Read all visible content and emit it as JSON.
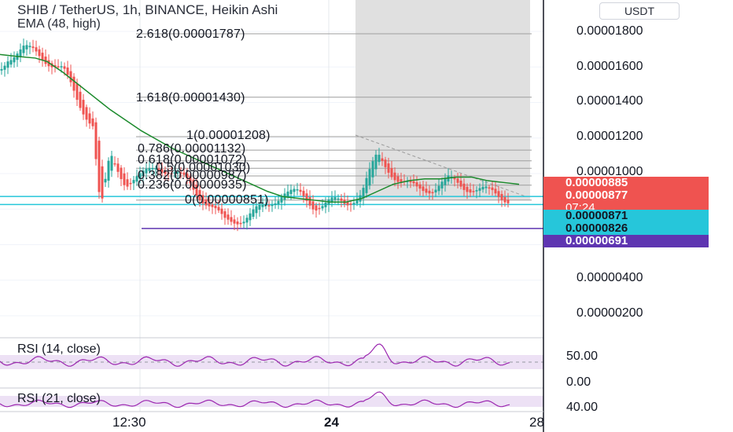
{
  "header": {
    "symbol_line": "SHIB / TetherUS, 1h, BINANCE, Heikin Ashi",
    "ema_label": "EMA (48, high)",
    "currency_button": "USDT"
  },
  "colors": {
    "up_candle": "#26a69a",
    "down_candle": "#ef5350",
    "ema_line": "#1b8a2c",
    "cyan_line": "#26c6da",
    "purple_line": "#5e35b1",
    "rsi_line": "#9c27b0",
    "rsi_band": "#ede1f5",
    "shade": "#e0e0e0"
  },
  "price_axis": {
    "ticks": [
      "0.00001800",
      "0.00001600",
      "0.00001400",
      "0.00001200",
      "0.00001000",
      "0.00000400",
      "0.00000200"
    ]
  },
  "price_labels": [
    {
      "text": "0.00000885",
      "color": "#ef5350"
    },
    {
      "text": "0.00000877",
      "color": "#ef5350"
    },
    {
      "text": "07:24",
      "color": "#ef5350"
    },
    {
      "text": "0.00000871",
      "color": "#26c6da"
    },
    {
      "text": "0.00000826",
      "color": "#26c6da"
    },
    {
      "text": "0.00000691",
      "color": "#5e35b1"
    }
  ],
  "fib_levels": [
    {
      "label": "2.618(0.00001787)",
      "value": 1.787e-05
    },
    {
      "label": "1.618(0.00001430)",
      "value": 1.43e-05
    },
    {
      "label": "1(0.00001208)",
      "value": 1.208e-05
    },
    {
      "label": "0.786(0.00001132)",
      "value": 1.132e-05
    },
    {
      "label": "0.618(0.00001072)",
      "value": 1.072e-05
    },
    {
      "label": "0.5(0.00001030)",
      "value": 1.03e-05
    },
    {
      "label": "0.382(0.00000987)",
      "value": 9.87e-06
    },
    {
      "label": "0.236(0.00000935)",
      "value": 9.35e-06
    },
    {
      "label": "0(0.00000851)",
      "value": 8.51e-06
    }
  ],
  "time_axis": {
    "ticks": [
      "12:30",
      "24",
      "28"
    ]
  },
  "rsi_panels": [
    {
      "label": "RSI (14, close)",
      "ticks": [
        "50.00",
        "0.00"
      ]
    },
    {
      "label": "RSI (21, close)",
      "ticks": [
        "40.00"
      ]
    }
  ],
  "chart_data": {
    "type": "candlestick",
    "title": "SHIB / TetherUS, 1h, BINANCE, Heikin Ashi",
    "y_axis": {
      "min": 2e-06,
      "max": 1.8e-05,
      "step": 2e-06
    },
    "ema": {
      "name": "EMA (48, high)",
      "points": [
        [
          0,
          1.67e-05
        ],
        [
          20,
          1.66e-05
        ],
        [
          45,
          1.65e-05
        ],
        [
          60,
          1.63e-05
        ],
        [
          80,
          1.57e-05
        ],
        [
          100,
          1.5e-05
        ],
        [
          120,
          1.43e-05
        ],
        [
          140,
          1.36e-05
        ],
        [
          160,
          1.3e-05
        ],
        [
          180,
          1.24e-05
        ],
        [
          200,
          1.19e-05
        ],
        [
          220,
          1.14e-05
        ],
        [
          240,
          1.1e-05
        ],
        [
          260,
          1.06e-05
        ],
        [
          280,
          1.02e-05
        ],
        [
          300,
          9.8e-06
        ],
        [
          320,
          9.4e-06
        ],
        [
          340,
          9e-06
        ],
        [
          360,
          8.7e-06
        ],
        [
          380,
          8.6e-06
        ],
        [
          400,
          8.5e-06
        ],
        [
          420,
          8.4e-06
        ],
        [
          440,
          8.4e-06
        ],
        [
          460,
          8.6e-06
        ],
        [
          480,
          9e-06
        ],
        [
          500,
          9.4e-06
        ],
        [
          520,
          9.6e-06
        ],
        [
          540,
          9.7e-06
        ],
        [
          560,
          9.7e-06
        ],
        [
          580,
          9.8e-06
        ],
        [
          600,
          9.8e-06
        ],
        [
          620,
          9.6e-06
        ],
        [
          640,
          9.5e-06
        ],
        [
          660,
          9.4e-06
        ]
      ]
    },
    "horizontal_lines": [
      {
        "name": "cyan-line-1",
        "value": 8.71e-06
      },
      {
        "name": "cyan-line-2",
        "value": 8.26e-06
      },
      {
        "name": "purple-line",
        "value": 6.91e-06
      }
    ]
  }
}
